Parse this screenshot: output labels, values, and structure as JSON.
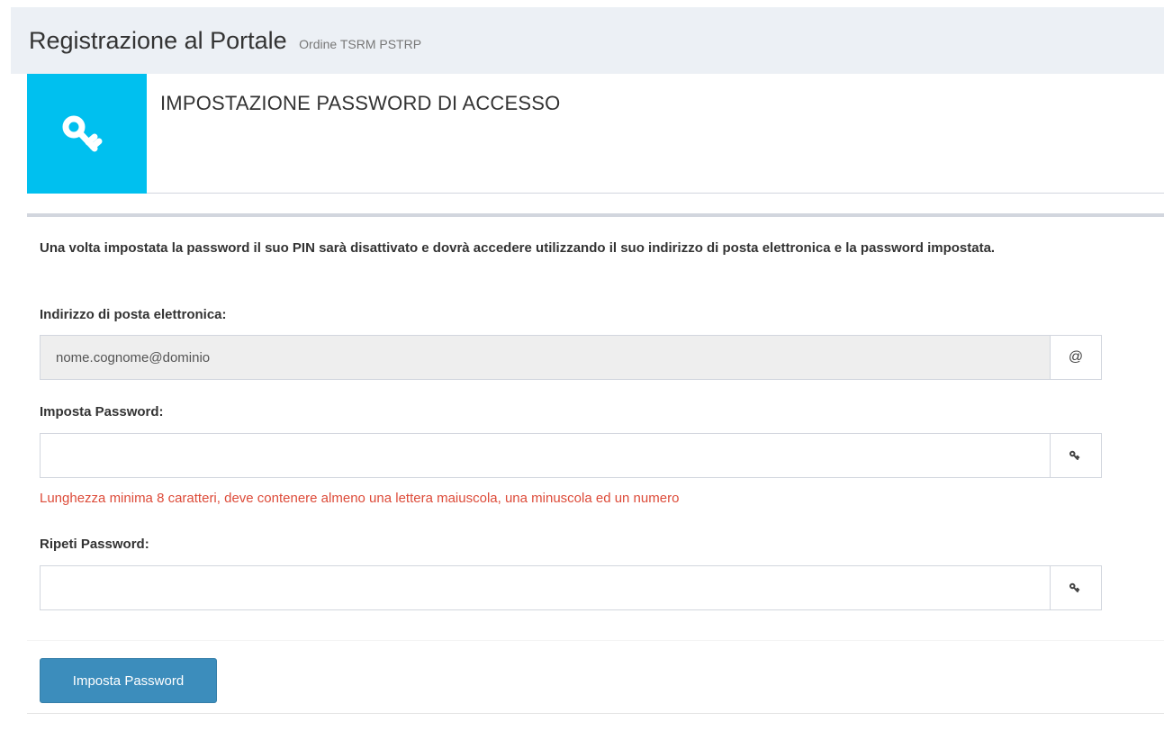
{
  "header": {
    "title": "Registrazione al Portale",
    "subtitle": "Ordine TSRM PSTRP"
  },
  "info_box": {
    "icon": "key-icon",
    "text": "IMPOSTAZIONE PASSWORD DI ACCESSO",
    "accent_color": "#00c0ef"
  },
  "form": {
    "intro": "Una volta impostata la password il suo PIN sarà disattivato e dovrà accedere utilizzando il suo indirizzo di posta elettronica e la password impostata.",
    "email": {
      "label": "Indirizzo di posta elettronica:",
      "value": "nome.cognome@dominio",
      "addon": "@"
    },
    "password": {
      "label": "Imposta Password:",
      "value": "",
      "addon_icon": "key-icon",
      "help": "Lunghezza minima 8 caratteri, deve contenere almeno una lettera maiuscola, una minuscola ed un numero"
    },
    "repeat_password": {
      "label": "Ripeti Password:",
      "value": "",
      "addon_icon": "key-icon"
    },
    "submit_label": "Imposta Password"
  },
  "colors": {
    "primary": "#3c8dbc",
    "error": "#dd4b39",
    "background": "#ecf0f5"
  }
}
